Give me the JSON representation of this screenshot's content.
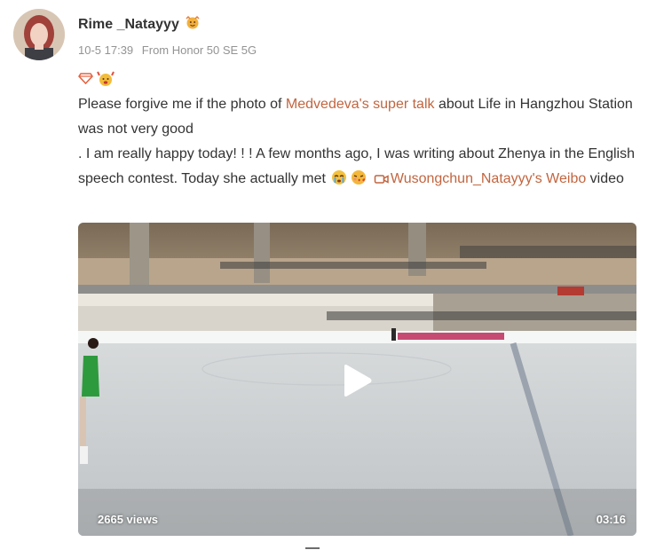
{
  "user": {
    "name": "Rime _Natayyy",
    "timestamp": "10-5 17:39",
    "source": "From Honor 50 SE 5G"
  },
  "post": {
    "line1_prefix": "Please forgive me if the photo of ",
    "line1_link": "Medvedeva's super talk",
    "line1_suffix": " about Life in Hangzhou Station was not very good",
    "line2": ". I am really happy today! ! ! A few months ago, I was writing about Zhenya in the English speech contest. Today she actually met ",
    "video_link": "Wusongchun_Natayyy's Weibo",
    "video_suffix": " video"
  },
  "video": {
    "views": "2665 views",
    "duration": "03:16"
  },
  "colors": {
    "link": "#c2653f",
    "username": "#333333",
    "meta": "#939393"
  },
  "icons": [
    "avatar-photo",
    "fan-badge-icon",
    "diamond-badge-icon",
    "emoji-crying",
    "emoji-kiss",
    "video-camera-icon",
    "play-icon"
  ]
}
